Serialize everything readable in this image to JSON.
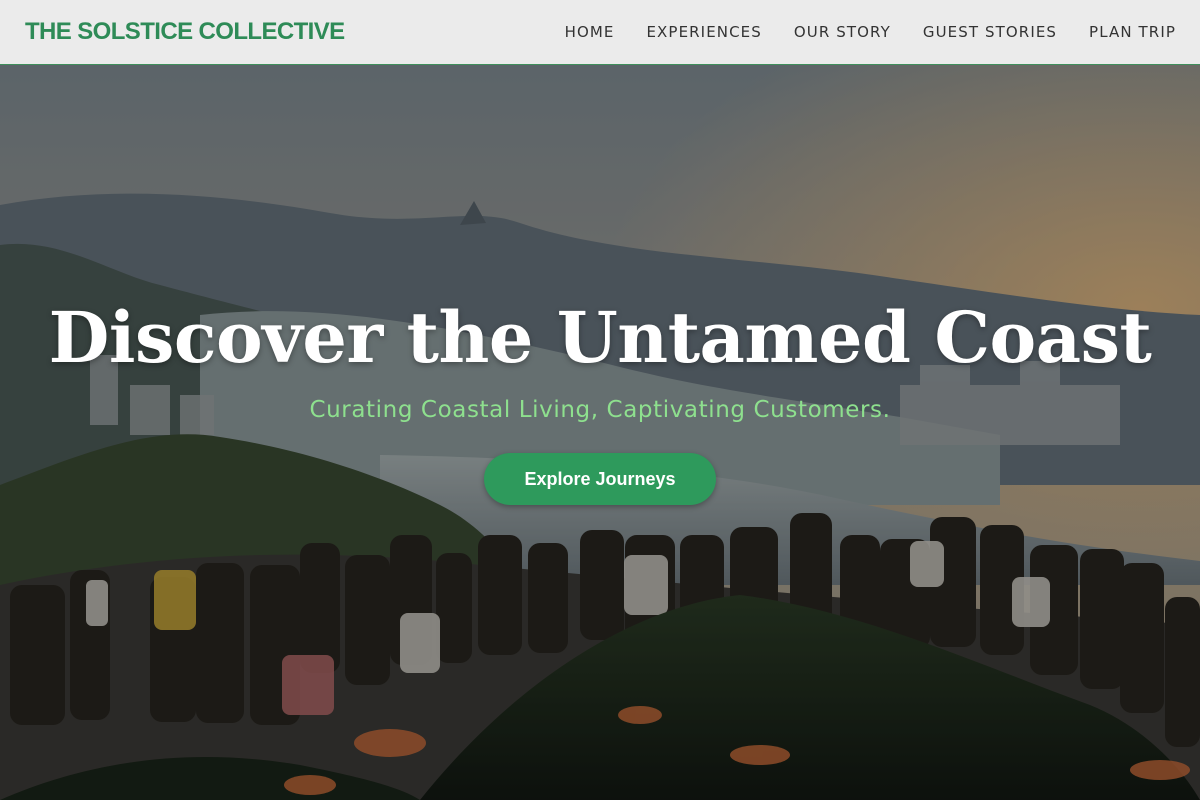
{
  "header": {
    "logo": "THE SOLSTICE COLLECTIVE",
    "nav": [
      "HOME",
      "EXPERIENCES",
      "OUR STORY",
      "GUEST STORIES",
      "PLAN TRIP"
    ]
  },
  "hero": {
    "title": "Discover the Untamed Coast",
    "subtitle": "Curating Coastal Living, Captivating Customers.",
    "cta_label": "Explore Journeys",
    "background_image": "coastal-viewpoint-crowd-photo"
  },
  "colors": {
    "brand": "#2e8b57",
    "cta": "#2e9a5c",
    "subtitle": "#8ee08e",
    "header_bg": "#ebebeb"
  }
}
